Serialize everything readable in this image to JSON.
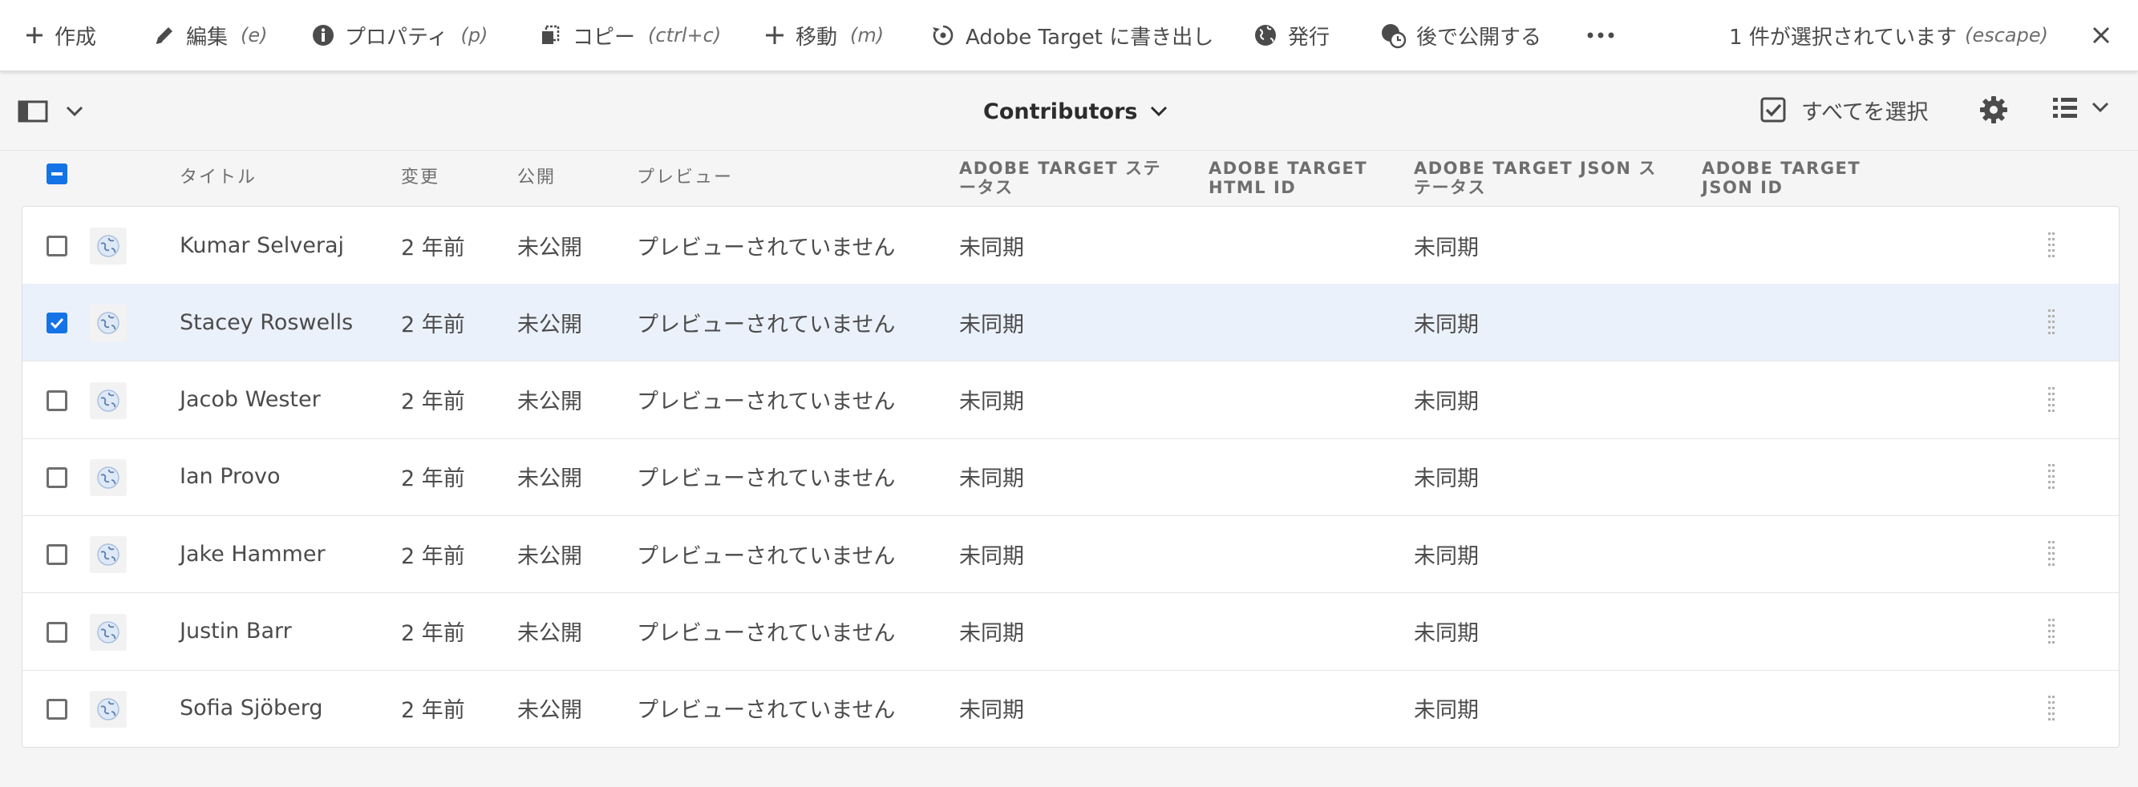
{
  "actionbar": {
    "create": {
      "label": "作成"
    },
    "edit": {
      "label": "編集",
      "shortcut": "(e)"
    },
    "properties": {
      "label": "プロパティ",
      "shortcut": "(p)"
    },
    "copy": {
      "label": "コピー",
      "shortcut": "(ctrl+c)"
    },
    "move": {
      "label": "移動",
      "shortcut": "(m)"
    },
    "export_target": {
      "label": "Adobe Target に書き出し"
    },
    "publish": {
      "label": "発行"
    },
    "publish_later": {
      "label": "後で公開する"
    },
    "more_icon": "more-icon",
    "selection": {
      "text": "1 件が選択されています",
      "shortcut": "(escape)"
    }
  },
  "viewbar": {
    "folder_title": "Contributors",
    "select_all": "すべてを選択"
  },
  "table": {
    "headers": {
      "title": "タイトル",
      "modified": "変更",
      "published": "公開",
      "preview": "プレビュー",
      "target_status": "ADOBE TARGET ステータス",
      "target_html_id": "ADOBE TARGET HTML ID",
      "target_json_status": "ADOBE TARGET JSON ステータス",
      "target_json_id": "ADOBE TARGET JSON ID"
    },
    "rows": [
      {
        "title": "Kumar Selveraj",
        "modified": "2 年前",
        "published": "未公開",
        "preview": "プレビューされていません",
        "target_status": "未同期",
        "target_html_id": "",
        "target_json_status": "未同期",
        "target_json_id": "",
        "selected": false
      },
      {
        "title": "Stacey Roswells",
        "modified": "2 年前",
        "published": "未公開",
        "preview": "プレビューされていません",
        "target_status": "未同期",
        "target_html_id": "",
        "target_json_status": "未同期",
        "target_json_id": "",
        "selected": true
      },
      {
        "title": "Jacob Wester",
        "modified": "2 年前",
        "published": "未公開",
        "preview": "プレビューされていません",
        "target_status": "未同期",
        "target_html_id": "",
        "target_json_status": "未同期",
        "target_json_id": "",
        "selected": false
      },
      {
        "title": "Ian Provo",
        "modified": "2 年前",
        "published": "未公開",
        "preview": "プレビューされていません",
        "target_status": "未同期",
        "target_html_id": "",
        "target_json_status": "未同期",
        "target_json_id": "",
        "selected": false
      },
      {
        "title": "Jake Hammer",
        "modified": "2 年前",
        "published": "未公開",
        "preview": "プレビューされていません",
        "target_status": "未同期",
        "target_html_id": "",
        "target_json_status": "未同期",
        "target_json_id": "",
        "selected": false
      },
      {
        "title": "Justin Barr",
        "modified": "2 年前",
        "published": "未公開",
        "preview": "プレビューされていません",
        "target_status": "未同期",
        "target_html_id": "",
        "target_json_status": "未同期",
        "target_json_id": "",
        "selected": false
      },
      {
        "title": "Sofia Sjöberg",
        "modified": "2 年前",
        "published": "未公開",
        "preview": "プレビューされていません",
        "target_status": "未同期",
        "target_html_id": "",
        "target_json_status": "未同期",
        "target_json_id": "",
        "selected": false
      }
    ]
  },
  "colors": {
    "accent": "#1473e6",
    "selected_row": "#ebf1fb",
    "text": "#4b4b4b"
  }
}
